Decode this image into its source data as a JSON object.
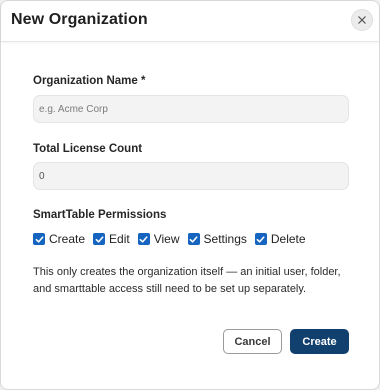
{
  "modal": {
    "title": "New Organization"
  },
  "fields": {
    "org_name": {
      "label": "Organization Name *",
      "value": "",
      "placeholder": "e.g. Acme Corp"
    },
    "license_count": {
      "label": "Total License Count",
      "value": "0"
    }
  },
  "permissions": {
    "label": "SmartTable Permissions",
    "items": [
      {
        "label": "Create",
        "checked": true
      },
      {
        "label": "Edit",
        "checked": true
      },
      {
        "label": "View",
        "checked": true
      },
      {
        "label": "Settings",
        "checked": true
      },
      {
        "label": "Delete",
        "checked": true
      }
    ]
  },
  "note": "This only creates the organization itself — an initial user, folder, and smarttable access still need to be set up separately.",
  "actions": {
    "cancel_label": "Cancel",
    "create_label": "Create"
  },
  "colors": {
    "primary": "#12406e",
    "checkbox": "#1565c0"
  }
}
